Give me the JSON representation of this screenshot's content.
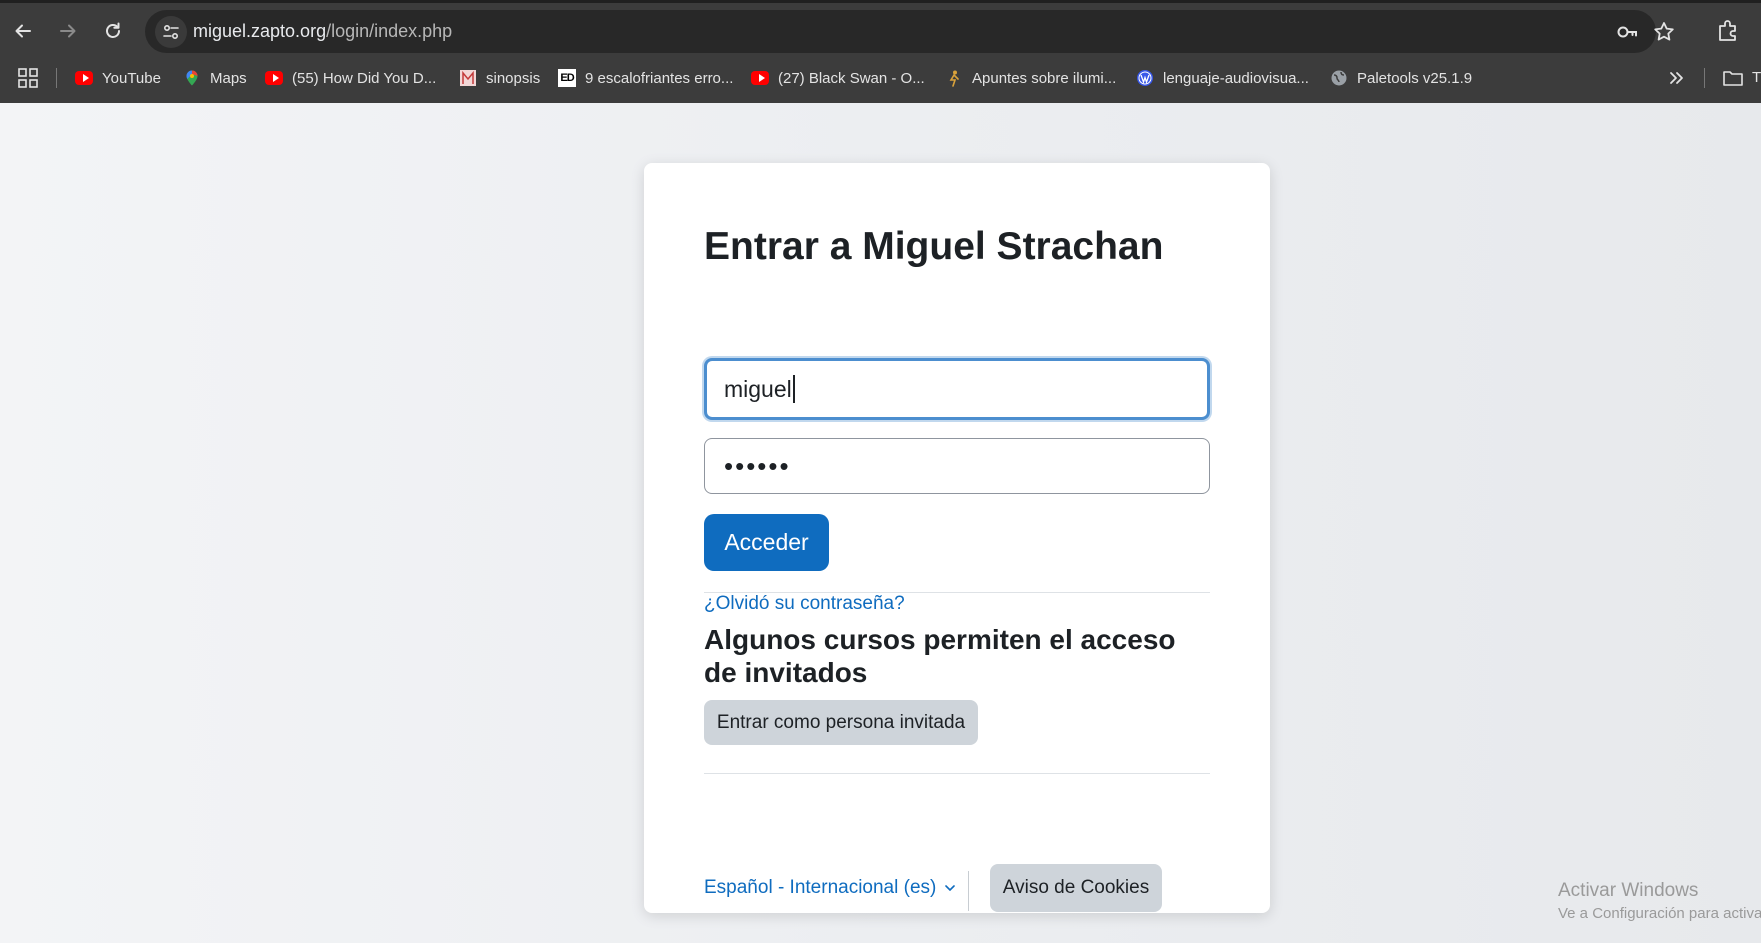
{
  "browser": {
    "url_host": "miguel.zapto.org",
    "url_path": "/login/index.php",
    "bookmarks": [
      {
        "label": "YouTube",
        "icon": "youtube-icon"
      },
      {
        "label": "Maps",
        "icon": "maps-pin-icon"
      },
      {
        "label": "(55) How Did You D...",
        "icon": "youtube-icon"
      },
      {
        "label": "sinopsis",
        "icon": "bookmark-favicon"
      },
      {
        "label": "9 escalofriantes erro...",
        "icon": "ed-favicon"
      },
      {
        "label": "(27) Black Swan - O...",
        "icon": "youtube-icon"
      },
      {
        "label": "Apuntes sobre ilumi...",
        "icon": "figure-favicon"
      },
      {
        "label": "lenguaje-audiovisua...",
        "icon": "wordpress-icon"
      },
      {
        "label": "Paletools v25.1.9",
        "icon": "globe-icon"
      }
    ],
    "overflow_folder_label": "T"
  },
  "login": {
    "title": "Entrar a Miguel Strachan",
    "username_value": "miguel",
    "password_value": "••••••",
    "submit_label": "Acceder",
    "forgot_link": "¿Olvidó su contraseña?",
    "guest_heading": "Algunos cursos permiten el acceso de invitados",
    "guest_button": "Entrar como persona invitada",
    "language_selector": "Español - Internacional (es)",
    "cookies_button": "Aviso de Cookies"
  },
  "watermark": {
    "line1": "Activar Windows",
    "line2": "Ve a Configuración para activar Windows."
  },
  "colors": {
    "primary": "#0f6cbf",
    "focus_ring": "#4c8ecf",
    "chrome_bg": "#3c3c3c"
  }
}
